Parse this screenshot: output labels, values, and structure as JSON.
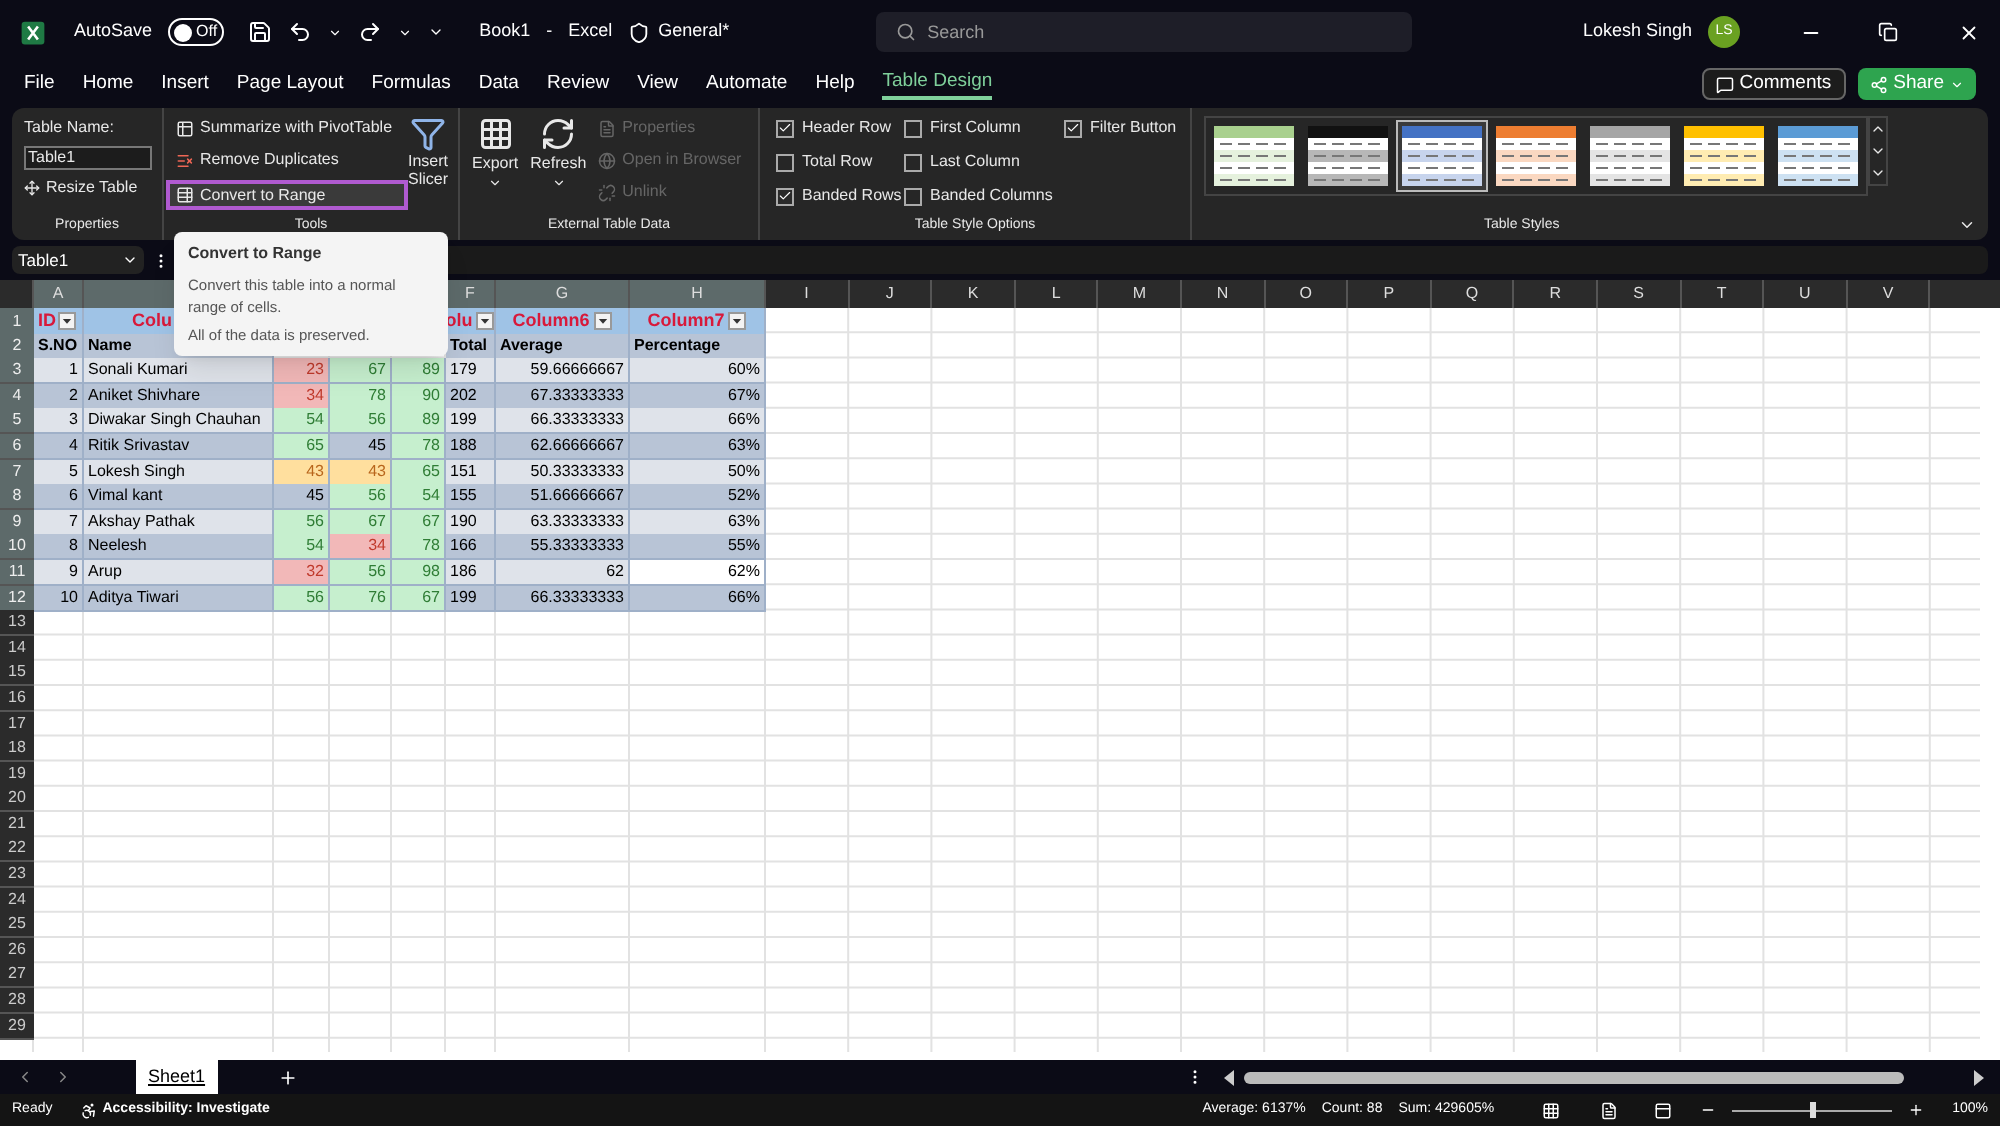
{
  "title_bar": {
    "autosave_label": "AutoSave",
    "autosave": {
      "label": "Off",
      "on": false
    },
    "document": "Book1",
    "separator": "-",
    "app": "Excel",
    "sensitivity": "General*",
    "search_placeholder": "Search",
    "user": "Lokesh Singh",
    "avatar": "LS"
  },
  "ribbon_tabs": [
    {
      "label": "File",
      "selected": false
    },
    {
      "label": "Home",
      "selected": false
    },
    {
      "label": "Insert",
      "selected": false
    },
    {
      "label": "Page Layout",
      "selected": false
    },
    {
      "label": "Formulas",
      "selected": false
    },
    {
      "label": "Data",
      "selected": false
    },
    {
      "label": "Review",
      "selected": false
    },
    {
      "label": "View",
      "selected": false
    },
    {
      "label": "Automate",
      "selected": false
    },
    {
      "label": "Help",
      "selected": false
    },
    {
      "label": "Table Design",
      "selected": true
    }
  ],
  "actions": {
    "comments": "Comments",
    "share": "Share"
  },
  "properties": {
    "name_label": "Table Name:",
    "name_value": "Table1",
    "resize": "Resize Table",
    "group": "Properties"
  },
  "tools": {
    "pivot": "Summarize with PivotTable",
    "duplicates": "Remove Duplicates",
    "convert": {
      "label": "Convert to Range",
      "highlighted": true
    },
    "slicer_line1": "Insert",
    "slicer_line2": "Slicer",
    "group": "Tools"
  },
  "external": {
    "export": "Export",
    "refresh": "Refresh",
    "items": [
      {
        "label": "Properties",
        "disabled": true
      },
      {
        "label": "Open in Browser",
        "disabled": true
      },
      {
        "label": "Unlink",
        "disabled": true
      }
    ],
    "group": "External Table Data"
  },
  "style_options": {
    "items": [
      {
        "label": "Header Row",
        "checked": true
      },
      {
        "label": "First Column",
        "checked": false
      },
      {
        "label": "Filter Button",
        "checked": true
      },
      {
        "label": "Total Row",
        "checked": false
      },
      {
        "label": "Last Column",
        "checked": false
      },
      {
        "label": "Banded Rows",
        "checked": true
      },
      {
        "label": "Banded Columns",
        "checked": false
      }
    ],
    "group": "Table Style Options"
  },
  "table_styles": {
    "items": [
      {
        "color": "#a9d08e",
        "selected": false
      },
      {
        "color": "#111111",
        "selected": false
      },
      {
        "color": "#4472c4",
        "selected": true
      },
      {
        "color": "#ed7d31",
        "selected": false
      },
      {
        "color": "#a5a5a5",
        "selected": false
      },
      {
        "color": "#ffc000",
        "selected": false
      },
      {
        "color": "#5b9bd5",
        "selected": false
      }
    ],
    "group": "Table Styles"
  },
  "name_box": "Table1",
  "tooltip": {
    "title": "Convert to Range",
    "body": "Convert this table into a normal range of cells.",
    "note": "All of the data is preserved."
  },
  "column_headers": [
    "A",
    "F",
    "G",
    "H",
    "I",
    "J",
    "K",
    "L",
    "M",
    "N",
    "O",
    "P",
    "Q",
    "R",
    "S",
    "T",
    "U",
    "V"
  ],
  "row_numbers": [
    "1",
    "2",
    "3",
    "4",
    "5",
    "6",
    "7",
    "8",
    "9",
    "10",
    "11",
    "12",
    "13",
    "14",
    "15",
    "16",
    "17",
    "18",
    "19",
    "20",
    "21",
    "22",
    "23",
    "24",
    "25",
    "26",
    "27",
    "28",
    "29"
  ],
  "title_row": {
    "a": "ID",
    "b": "Colu",
    "f": "olu",
    "g": "Column6",
    "h": "Column7"
  },
  "header_row": {
    "a": "S.NO",
    "b": "Name",
    "f": "Total",
    "g": "Average",
    "h": "Percentage"
  },
  "rows": [
    {
      "sno": "1",
      "name": "Sonali Kumari",
      "scores": [
        {
          "value": "23",
          "color": "#f2b8b8"
        },
        {
          "value": "67",
          "color": "#c6efce"
        },
        {
          "value": "89",
          "color": "#c6efce"
        }
      ],
      "total": "179",
      "average": "59.66666667",
      "percentage": "60%",
      "percentage_active": false
    },
    {
      "sno": "2",
      "name": "Aniket Shivhare",
      "scores": [
        {
          "value": "34",
          "color": "#f2b8b8"
        },
        {
          "value": "78",
          "color": "#c6efce"
        },
        {
          "value": "90",
          "color": "#c6efce"
        }
      ],
      "total": "202",
      "average": "67.33333333",
      "percentage": "67%",
      "percentage_active": false
    },
    {
      "sno": "3",
      "name": "Diwakar Singh Chauhan",
      "scores": [
        {
          "value": "54",
          "color": "#c6efce"
        },
        {
          "value": "56",
          "color": "#c6efce"
        },
        {
          "value": "89",
          "color": "#c6efce"
        }
      ],
      "total": "199",
      "average": "66.33333333",
      "percentage": "66%",
      "percentage_active": false
    },
    {
      "sno": "4",
      "name": "Ritik Srivastav",
      "scores": [
        {
          "value": "65",
          "color": "#c6efce"
        },
        {
          "value": "45"
        },
        {
          "value": "78",
          "color": "#c6efce"
        }
      ],
      "total": "188",
      "average": "62.66666667",
      "percentage": "63%",
      "percentage_active": false
    },
    {
      "sno": "5",
      "name": "Lokesh Singh",
      "scores": [
        {
          "value": "43",
          "color": "#ffdf9e"
        },
        {
          "value": "43",
          "color": "#ffdf9e"
        },
        {
          "value": "65",
          "color": "#c6efce"
        }
      ],
      "total": "151",
      "average": "50.33333333",
      "percentage": "50%",
      "percentage_active": false
    },
    {
      "sno": "6",
      "name": "Vimal kant",
      "scores": [
        {
          "value": "45"
        },
        {
          "value": "56",
          "color": "#c6efce"
        },
        {
          "value": "54",
          "color": "#c6efce"
        }
      ],
      "total": "155",
      "average": "51.66666667",
      "percentage": "52%",
      "percentage_active": false
    },
    {
      "sno": "7",
      "name": "Akshay Pathak",
      "scores": [
        {
          "value": "56",
          "color": "#c6efce"
        },
        {
          "value": "67",
          "color": "#c6efce"
        },
        {
          "value": "67",
          "color": "#c6efce"
        }
      ],
      "total": "190",
      "average": "63.33333333",
      "percentage": "63%",
      "percentage_active": false
    },
    {
      "sno": "8",
      "name": "Neelesh",
      "scores": [
        {
          "value": "54",
          "color": "#c6efce"
        },
        {
          "value": "34",
          "color": "#f2b8b8"
        },
        {
          "value": "78",
          "color": "#c6efce"
        }
      ],
      "total": "166",
      "average": "55.33333333",
      "percentage": "55%",
      "percentage_active": false
    },
    {
      "sno": "9",
      "name": "Arup",
      "scores": [
        {
          "value": "32",
          "color": "#f2b8b8"
        },
        {
          "value": "56",
          "color": "#c6efce"
        },
        {
          "value": "98",
          "color": "#c6efce"
        }
      ],
      "total": "186",
      "average": "62",
      "percentage": "62%",
      "percentage_active": true
    },
    {
      "sno": "10",
      "name": "Aditya Tiwari",
      "scores": [
        {
          "value": "56",
          "color": "#c6efce"
        },
        {
          "value": "76",
          "color": "#c6efce"
        },
        {
          "value": "67",
          "color": "#c6efce"
        }
      ],
      "total": "199",
      "average": "66.33333333",
      "percentage": "66%",
      "percentage_active": false
    }
  ],
  "sheet_tabs": [
    {
      "label": "Sheet1",
      "selected": true
    }
  ],
  "status_bar": {
    "ready": "Ready",
    "accessibility": "Accessibility: Investigate",
    "average": "Average: 6137%",
    "count": "Count: 88",
    "sum": "Sum: 429605%",
    "zoom": {
      "level": 0.5
    },
    "zoom_label": "100%"
  }
}
